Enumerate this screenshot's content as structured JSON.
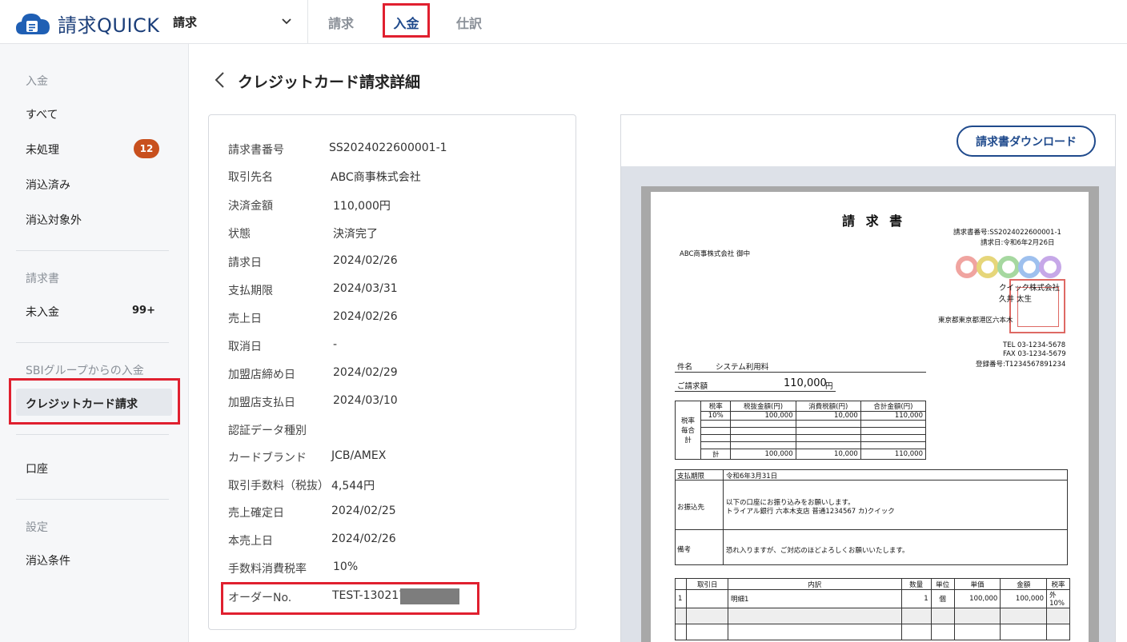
{
  "header": {
    "logo_text": "請求QUICK",
    "product_select": "請求",
    "nav": [
      {
        "label": "請求",
        "active": false
      },
      {
        "label": "入金",
        "active": true
      },
      {
        "label": "仕訳",
        "active": false
      }
    ]
  },
  "sidebar": {
    "sections": [
      {
        "title": "入金",
        "items": [
          {
            "label": "すべて"
          },
          {
            "label": "未処理",
            "badge": "12"
          },
          {
            "label": "消込済み"
          },
          {
            "label": "消込対象外"
          }
        ]
      },
      {
        "title": "請求書",
        "items": [
          {
            "label": "未入金",
            "count": "99+"
          }
        ]
      },
      {
        "title": "SBIグループからの入金",
        "items": [
          {
            "label": "クレジットカード請求",
            "active": true
          }
        ]
      },
      {
        "title": "",
        "items": [
          {
            "label": "口座"
          }
        ]
      },
      {
        "title": "設定",
        "items": [
          {
            "label": "消込条件"
          }
        ]
      }
    ]
  },
  "page": {
    "title": "クレジットカード請求詳細",
    "download_button": "請求書ダウンロード"
  },
  "details": [
    {
      "label": "請求書番号",
      "value": "SS2024022600001-1"
    },
    {
      "label": "取引先名",
      "value": "ABC商事株式会社"
    },
    {
      "label": "決済金額",
      "value": "110,000円"
    },
    {
      "label": "状態",
      "value": "決済完了"
    },
    {
      "label": "請求日",
      "value": "2024/02/26"
    },
    {
      "label": "支払期限",
      "value": "2024/03/31"
    },
    {
      "label": "売上日",
      "value": "2024/02/26"
    },
    {
      "label": "取消日",
      "value": "-"
    },
    {
      "label": "加盟店締め日",
      "value": "2024/02/29"
    },
    {
      "label": "加盟店支払日",
      "value": "2024/03/10"
    },
    {
      "label": "認証データ種別",
      "value": ""
    },
    {
      "label": "カードブランド",
      "value": "JCB/AMEX"
    },
    {
      "label": "取引手数料（税抜）",
      "value": "4,544円"
    },
    {
      "label": "売上確定日",
      "value": "2024/02/25"
    },
    {
      "label": "本売上日",
      "value": "2024/02/26"
    },
    {
      "label": "手数料消費税率",
      "value": "10%"
    },
    {
      "label": "オーダーNo.",
      "value": "TEST-130217-"
    }
  ],
  "invoice": {
    "title": "請 求 書",
    "number": "請求書番号:SS2024022600001-1",
    "date": "請求日:令和6年2月26日",
    "client": "ABC商事株式会社  御中",
    "company": "クイック株式会社",
    "person": "久井 太生",
    "address": "東京都東京都港区六本木",
    "tel": "TEL 03-1234-5678",
    "fax": "FAX 03-1234-5679",
    "reg": "登録番号:T1234567891234",
    "subject_label": "件名",
    "subject": "システム利用料",
    "amount_label": "ご請求額",
    "amount": "110,000",
    "amount_unit": "円",
    "tax_headers": [
      "税率",
      "税抜金額(円)",
      "消費税額(円)",
      "合計金額(円)"
    ],
    "tax_side": "税率毎合計",
    "tax_row": [
      "10%",
      "100,000",
      "10,000",
      "110,000"
    ],
    "tax_total": [
      "計",
      "100,000",
      "10,000",
      "110,000"
    ],
    "due_label": "支払期限",
    "due": "令和6年3月31日",
    "bank_label": "お振込先",
    "bank_line1": "以下の口座にお振り込みをお願いします。",
    "bank_line2": "トライアル銀行 六本木支店 普通1234567 カ)クイック",
    "note_label": "備考",
    "note": "恐れ入りますが、ご対応のほどよろしくお願いいたします。",
    "item_headers": [
      "取引日",
      "内訳",
      "数量",
      "単位",
      "単価",
      "金額",
      "税率"
    ],
    "item_row": [
      "1",
      "",
      "明細1",
      "1",
      "個",
      "100,000",
      "100,000",
      "外10%"
    ]
  }
}
